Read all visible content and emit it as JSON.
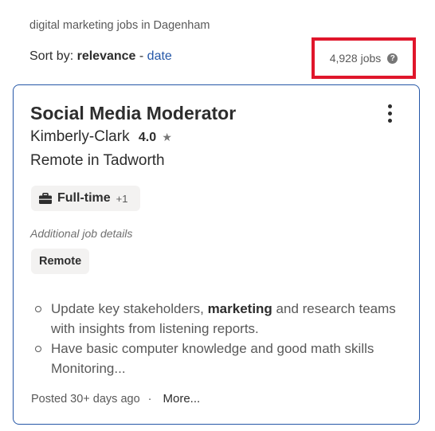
{
  "search": {
    "query": "digital marketing jobs in Dagenham"
  },
  "sort": {
    "prefix": "Sort by:",
    "active": "relevance",
    "separator": "-",
    "alternate": "date"
  },
  "results": {
    "count": "4,928 jobs",
    "help_glyph": "?"
  },
  "job": {
    "title": "Social Media Moderator",
    "company": "Kimberly-Clark",
    "rating": "4.0",
    "star_glyph": "★",
    "location": "Remote in Tadworth",
    "job_type": "Full-time",
    "job_type_extra": "+1",
    "additional_label": "Additional job details",
    "additional_badge": "Remote",
    "snippet": {
      "bullet1_before": "Update key stakeholders, ",
      "bullet1_bold": "marketing",
      "bullet1_after": " and research teams with insights from listening reports.",
      "bullet2": "Have basic computer knowledge and good math skills Monitoring..."
    },
    "posted": "Posted 30+ days ago",
    "dot": "·",
    "more_link": "More..."
  },
  "colors": {
    "link": "#2557a7",
    "highlight_box": "#e0162b",
    "badge_bg": "#f3f2f1",
    "text": "#2d2d2d"
  },
  "icons": [
    "help-icon",
    "more-vertical-icon",
    "star-icon",
    "briefcase-icon",
    "bullet-icon"
  ]
}
